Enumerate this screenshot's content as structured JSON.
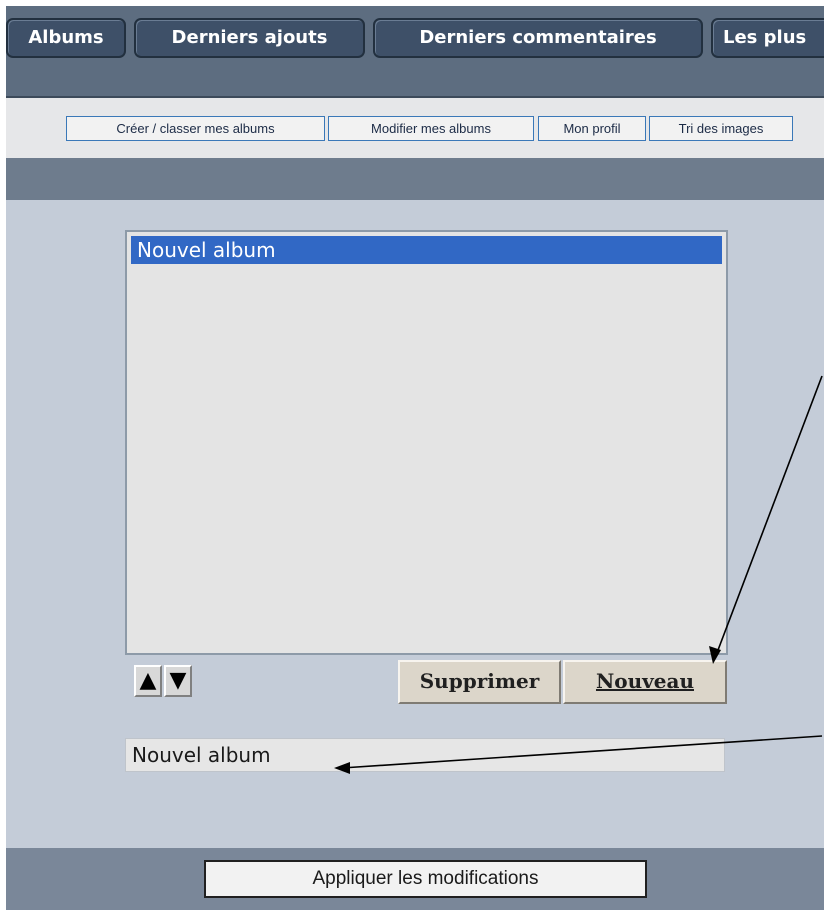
{
  "nav_tabs": [
    "Albums",
    "Derniers ajouts",
    "Derniers commentaires",
    "Les plus"
  ],
  "sub_links": [
    "Créer / classer mes albums",
    "Modifier mes albums",
    "Mon profil",
    "Tri des images"
  ],
  "album_list": {
    "items": [
      "Nouvel album"
    ],
    "selected_index": 0
  },
  "buttons": {
    "move_up": "▲",
    "move_down": "▼",
    "delete": "Supprimer",
    "new": "Nouveau"
  },
  "album_name": {
    "value": "Nouvel album"
  },
  "apply_label": "Appliquer les modifications",
  "annotation": {
    "color": "#000000"
  }
}
